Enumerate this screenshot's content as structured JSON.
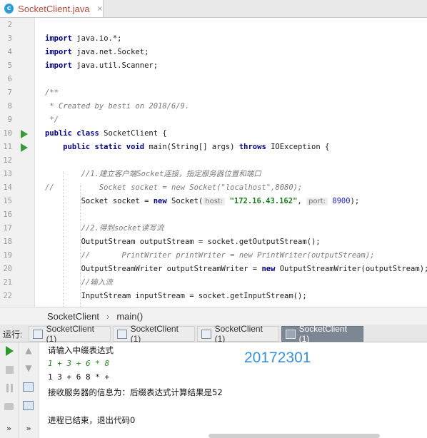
{
  "editor_tab": {
    "icon": "c",
    "filename": "SocketClient.java",
    "close": "×"
  },
  "lines": [
    {
      "n": "2",
      "segs": []
    },
    {
      "n": "3",
      "segs": [
        {
          "t": "import",
          "c": "kw"
        },
        {
          "t": " java.io.*;",
          "c": ""
        }
      ]
    },
    {
      "n": "4",
      "segs": [
        {
          "t": "import",
          "c": "kw"
        },
        {
          "t": " java.net.Socket;",
          "c": ""
        }
      ]
    },
    {
      "n": "5",
      "segs": [
        {
          "t": "import",
          "c": "kw"
        },
        {
          "t": " java.util.Scanner;",
          "c": ""
        }
      ]
    },
    {
      "n": "6",
      "segs": []
    },
    {
      "n": "7",
      "segs": [
        {
          "t": "/**",
          "c": "dcm"
        }
      ]
    },
    {
      "n": "8",
      "segs": [
        {
          "t": " * Created by besti on 2018/6/9.",
          "c": "dcm"
        }
      ]
    },
    {
      "n": "9",
      "segs": [
        {
          "t": " */",
          "c": "dcm"
        }
      ]
    },
    {
      "n": "10",
      "run": true,
      "segs": [
        {
          "t": "public class",
          "c": "kw"
        },
        {
          "t": " SocketClient {",
          "c": ""
        }
      ]
    },
    {
      "n": "11",
      "run": true,
      "segs": [
        {
          "t": "    public static void",
          "c": "kw"
        },
        {
          "t": " main(String[] args) ",
          "c": ""
        },
        {
          "t": "throws",
          "c": "kw"
        },
        {
          "t": " IOException {",
          "c": ""
        }
      ]
    },
    {
      "n": "12",
      "segs": []
    },
    {
      "n": "13",
      "segs": [
        {
          "t": "        //1.建立客户端Socket连接，指定服务器位置和端口",
          "c": "cm"
        }
      ]
    },
    {
      "n": "14",
      "segs": [
        {
          "t": "//          Socket socket = new Socket(\"localhost\",8080);",
          "c": "cm"
        }
      ]
    },
    {
      "n": "15",
      "segs": [
        {
          "t": "        Socket socket = ",
          "c": ""
        },
        {
          "t": "new",
          "c": "kw"
        },
        {
          "t": " Socket(",
          "c": ""
        },
        {
          "t": "host:",
          "c": "hint"
        },
        {
          "t": " ",
          "c": ""
        },
        {
          "t": "\"172.16.43.162\"",
          "c": "str"
        },
        {
          "t": ", ",
          "c": ""
        },
        {
          "t": "port:",
          "c": "hint"
        },
        {
          "t": " ",
          "c": ""
        },
        {
          "t": "8900",
          "c": "num"
        },
        {
          "t": ");",
          "c": ""
        }
      ]
    },
    {
      "n": "16",
      "segs": []
    },
    {
      "n": "17",
      "segs": [
        {
          "t": "        //2.得到socket读写流",
          "c": "cm"
        }
      ]
    },
    {
      "n": "18",
      "segs": [
        {
          "t": "        OutputStream outputStream = socket.getOutputStream();",
          "c": ""
        }
      ]
    },
    {
      "n": "19",
      "segs": [
        {
          "t": "        //       PrintWriter printWriter = new PrintWriter(outputStream);",
          "c": "cm"
        }
      ]
    },
    {
      "n": "20",
      "segs": [
        {
          "t": "        OutputStreamWriter outputStreamWriter = ",
          "c": ""
        },
        {
          "t": "new",
          "c": "kw"
        },
        {
          "t": " OutputStreamWriter(outputStream);",
          "c": ""
        }
      ]
    },
    {
      "n": "21",
      "segs": [
        {
          "t": "        //输入流",
          "c": "cm"
        }
      ]
    },
    {
      "n": "22",
      "segs": [
        {
          "t": "        InputStream inputStream = socket.getInputStream();",
          "c": ""
        }
      ]
    }
  ],
  "breadcrumb": {
    "class_name": "SocketClient",
    "separator": "›",
    "method": "main()"
  },
  "run_panel": {
    "label": "运行:",
    "tabs": [
      {
        "label": "SocketClient (1)",
        "active": false
      },
      {
        "label": "SocketClient (1)",
        "active": false
      },
      {
        "label": "SocketClient (1)",
        "active": false
      },
      {
        "label": "SocketClient (1)",
        "active": true
      }
    ],
    "more": "»"
  },
  "console": {
    "lines": [
      {
        "text": "请输入中缀表达式",
        "style": ""
      },
      {
        "text": "1 + 3 + 6 * 8",
        "style": "input"
      },
      {
        "text": "1 3 + 6 8 * +",
        "style": "mono"
      },
      {
        "text": "接收服务器的信息为：后缀表达式计算结果是52",
        "style": ""
      },
      {
        "text": "",
        "style": ""
      },
      {
        "text": "进程已结束，退出代码0",
        "style": ""
      }
    ],
    "watermark": "20172301"
  }
}
